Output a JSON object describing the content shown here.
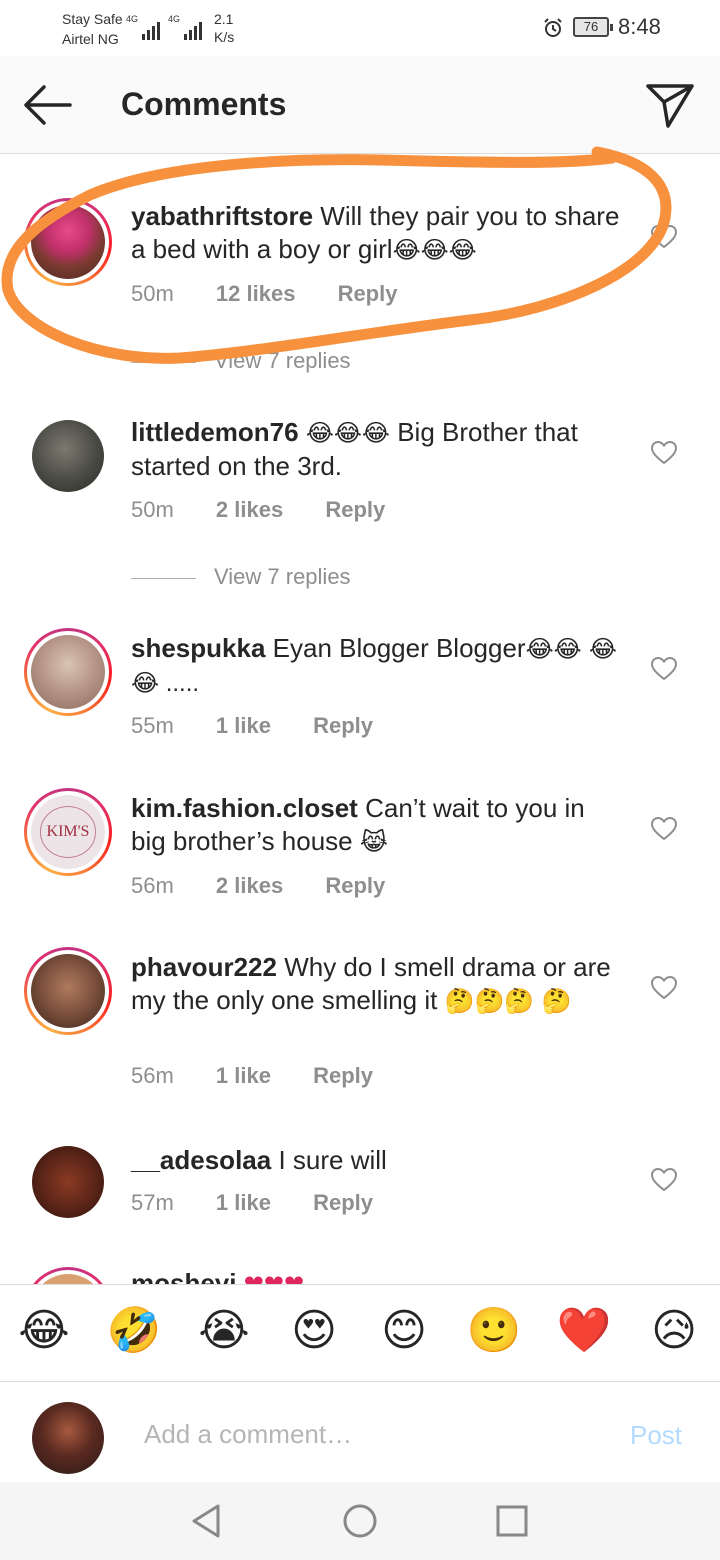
{
  "status_bar": {
    "carrier_line1": "Stay Safe",
    "carrier_line2": "Airtel NG",
    "network1": "4G",
    "network2": "4G",
    "speed_value": "2.1",
    "speed_unit": "K/s",
    "battery": "76",
    "time": "8:48"
  },
  "header": {
    "title": "Comments",
    "back_icon": "arrow-left-icon",
    "send_icon": "paper-plane-icon"
  },
  "comments": [
    {
      "user": "yabathriftstore",
      "text": "Will they pair you to share a bed with a boy or girl",
      "emoji": "😂😂😂",
      "time": "50m",
      "likes": "12 likes",
      "reply": "Reply",
      "view_replies": "View 7 replies",
      "avatar_color": "#b83a4a"
    },
    {
      "user": "littledemon76",
      "emoji": "😂😂😂",
      "text": "Big Brother that started on the 3rd.",
      "time": "50m",
      "likes": "2 likes",
      "reply": "Reply",
      "view_replies": "View 7 replies",
      "avatar_color": "#4a4a44"
    },
    {
      "user": "shespukka",
      "text": "Eyan Blogger Blogger",
      "emoji": "😂😂",
      "text2": "😂😂 .....",
      "time": "55m",
      "likes": "1 like",
      "reply": "Reply",
      "avatar_color": "#c9b8a8"
    },
    {
      "user": "kim.fashion.closet",
      "text": "Can’t wait to you in big brother’s house",
      "emoji": "😹",
      "time": "56m",
      "likes": "2 likes",
      "reply": "Reply",
      "avatar_label": "KIM'S",
      "avatar_color": "#e8e0e2"
    },
    {
      "user": "phavour222",
      "text": "Why do I smell drama or are my the only one smelling it",
      "emoji": "🤔🤔🤔",
      "emoji2": "🤔",
      "time": "56m",
      "likes": "1 like",
      "reply": "Reply",
      "avatar_color": "#7a4f3c"
    },
    {
      "user": "__adesolaa",
      "text": "I sure will",
      "time": "57m",
      "likes": "1 like",
      "reply": "Reply",
      "avatar_color": "#5a2418"
    },
    {
      "user": "mosheyi",
      "emoji": "❤❤❤"
    }
  ],
  "emoji_bar": [
    "😂",
    "🤣",
    "😭",
    "😍",
    "😊",
    "🙂",
    "❤️",
    "😥"
  ],
  "input": {
    "placeholder": "Add a comment…",
    "post_label": "Post"
  },
  "colors": {
    "annotation": "#f7913d",
    "post_disabled": "#b3dbff",
    "meta_gray": "#8e8e8e"
  }
}
